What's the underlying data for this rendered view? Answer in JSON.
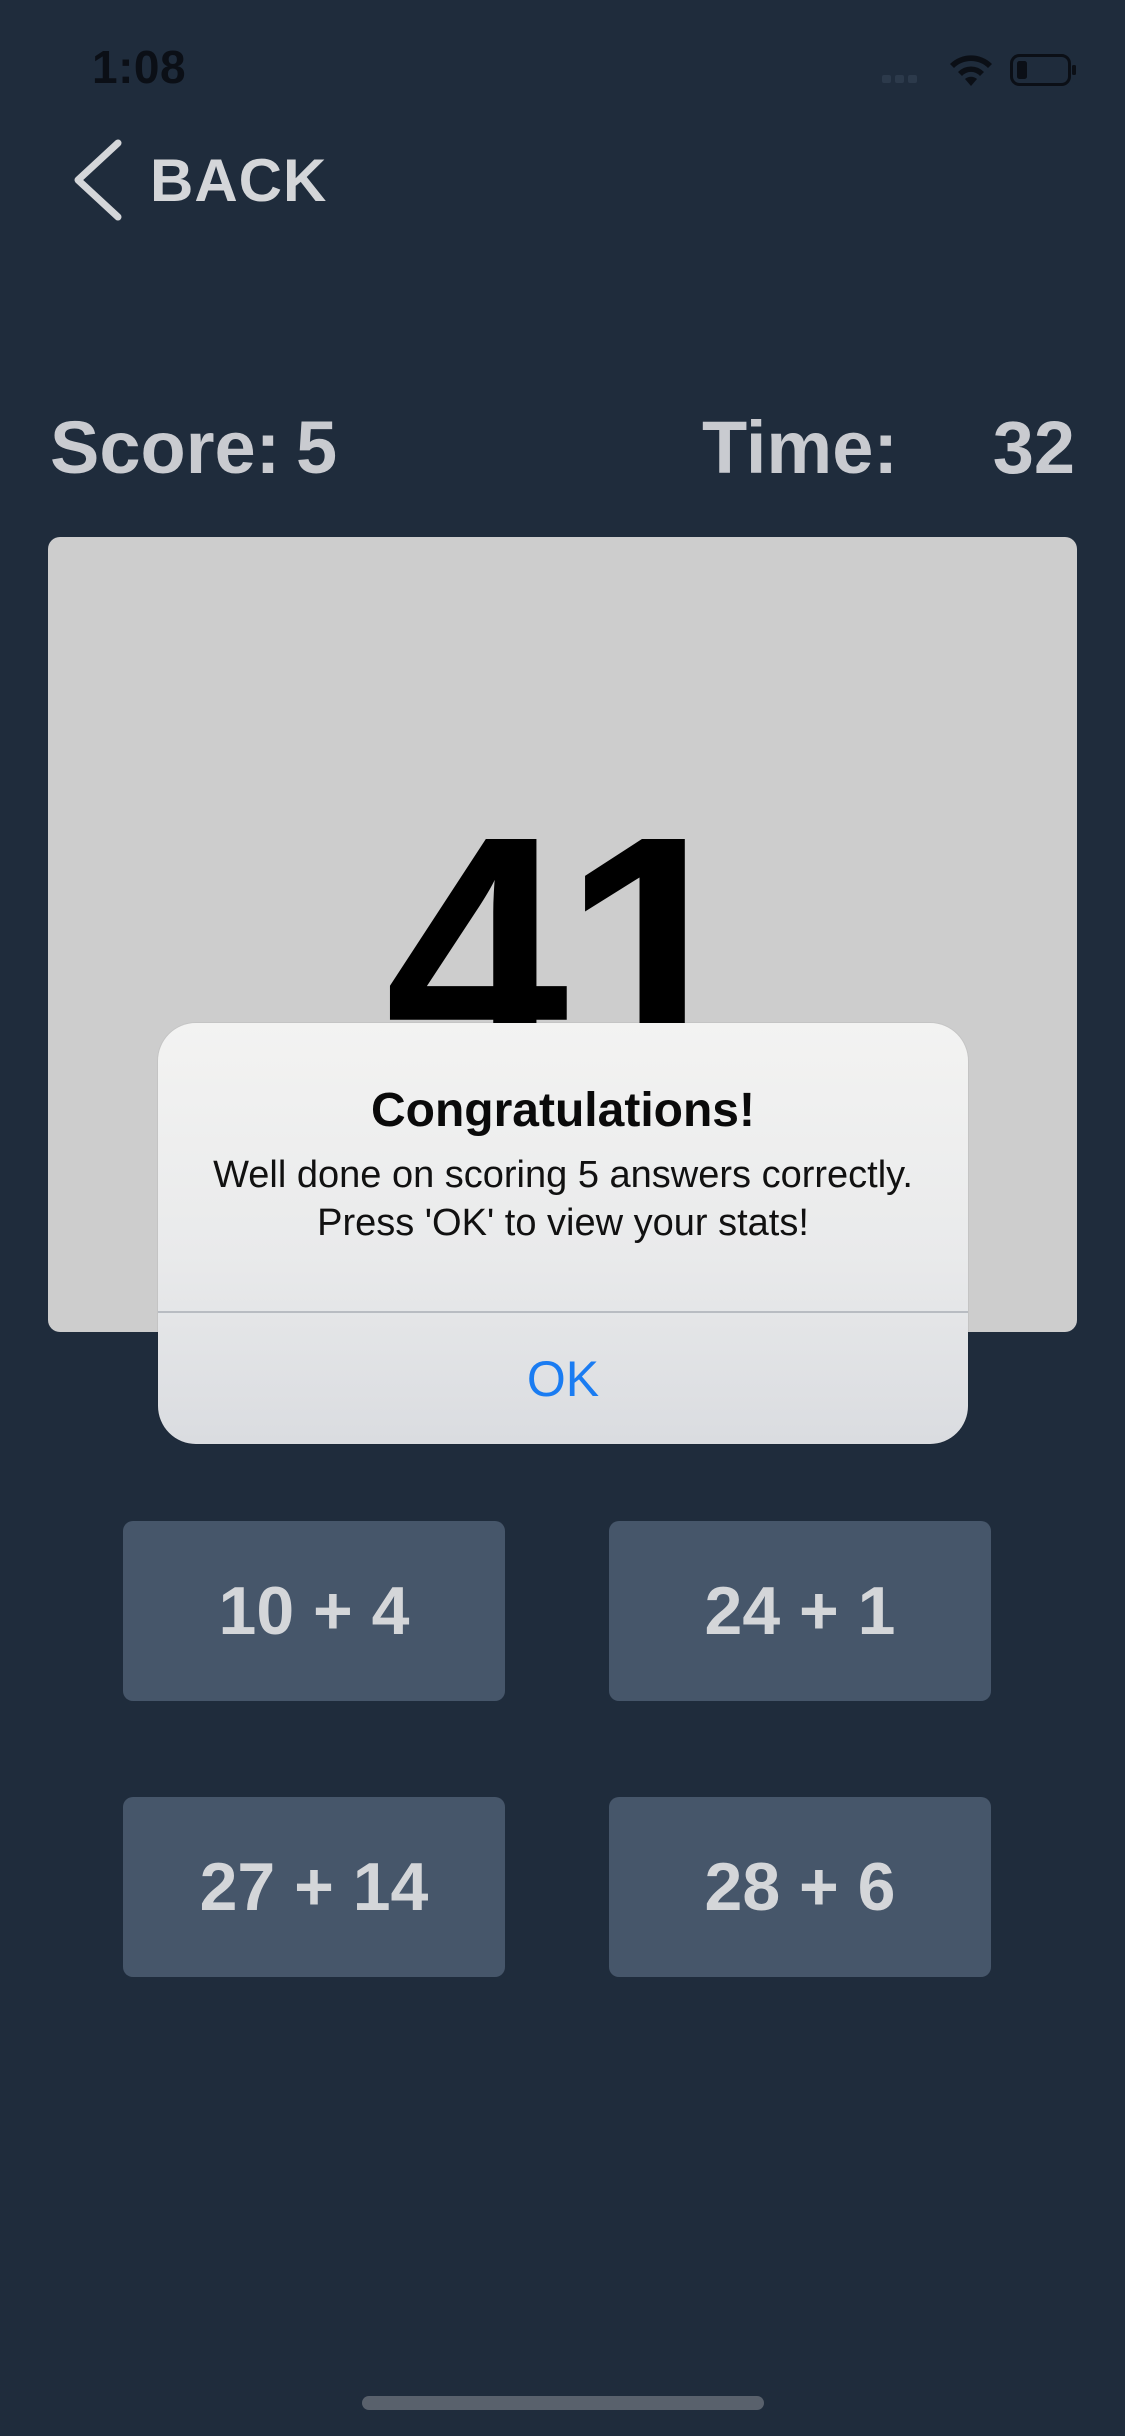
{
  "status_bar": {
    "time": "1:08",
    "icons": [
      "signal-icon",
      "wifi-icon",
      "battery-icon"
    ]
  },
  "nav": {
    "back_label": "BACK",
    "back_icon": "chevron-left-icon"
  },
  "scoreboard": {
    "score_label": "Score:",
    "score_value": "5",
    "time_label": "Time:",
    "time_value": "32"
  },
  "target": {
    "number": "41"
  },
  "alert": {
    "title": "Congratulations!",
    "message": "Well done on scoring 5 answers correctly. Press 'OK' to view your stats!",
    "ok_label": "OK"
  },
  "answers": [
    {
      "label": "10 + 4"
    },
    {
      "label": "24 + 1"
    },
    {
      "label": "27 + 14"
    },
    {
      "label": "28 + 6"
    }
  ],
  "colors": {
    "background": "#1f2c3c",
    "card": "#cdcdcd",
    "button": "#46566a",
    "text_light": "#d4d6d9",
    "link_blue": "#1a7cf2"
  }
}
